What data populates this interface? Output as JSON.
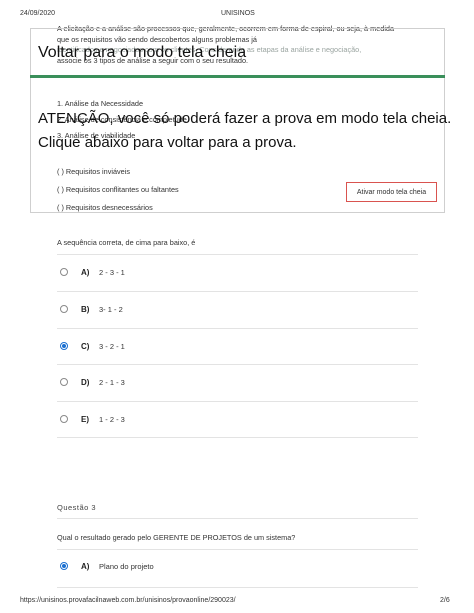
{
  "print_header": {
    "date": "24/09/2020",
    "title": "UNISINOS"
  },
  "question2": {
    "intro_lines": [
      "A elicitação e a análise são processos que, geralmente, ocorrem em forma de espiral, ou seja, à medida",
      "que os requisitos vão sendo descobertos alguns problemas já",
      "identificados e negociados com os clientes. Considerando as etapas da análise e negociação,",
      "associe os 3 tipos de análise a seguir com o seu resultado."
    ],
    "analysis_types": [
      "1. Análise da Necessidade",
      "2. Análise de consistência e completude",
      "3. Análise de viabilidade"
    ],
    "results": [
      "( ) Requisitos inviáveis",
      "( ) Requisitos conflitantes ou faltantes",
      "( ) Requisitos desnecessários"
    ],
    "prompt": "A sequência correta, de cima para baixo, é",
    "options": [
      {
        "letter": "A)",
        "value": "2 - 3 - 1",
        "checked": false
      },
      {
        "letter": "B)",
        "value": "3- 1 - 2",
        "checked": false
      },
      {
        "letter": "C)",
        "value": "3 - 2 - 1",
        "checked": true
      },
      {
        "letter": "D)",
        "value": "2 - 1 - 3",
        "checked": false
      },
      {
        "letter": "E)",
        "value": "1 - 2 - 3",
        "checked": false
      }
    ]
  },
  "fullscreen_overlay": {
    "title": "Voltar para o modo tela cheia",
    "warning_line1": "ATENÇÃO, você só poderá fazer a prova em modo tela cheia.",
    "warning_line2": "Clique abaixo para voltar para a prova.",
    "button_label": "Ativar modo tela cheia",
    "button_border_color": "#d9534f",
    "bar_color": "#3a8f5a"
  },
  "question3": {
    "label": "Questão 3",
    "prompt": "Qual o resultado gerado pelo GERENTE DE PROJETOS de um sistema?",
    "options": [
      {
        "letter": "A)",
        "value": "Plano do projeto",
        "checked": true
      }
    ]
  },
  "print_footer": {
    "url": "https://unisinos.provafacilnaweb.com.br/unisinos/provaonline/290023/",
    "page": "2/6"
  }
}
